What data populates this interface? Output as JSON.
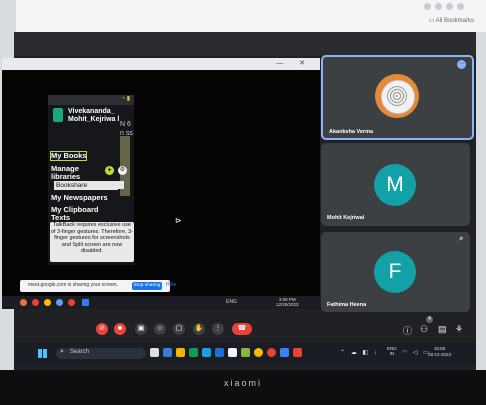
{
  "browser": {
    "bookmarks_label": "All Bookmarks"
  },
  "device": {
    "brand": "xiaomi"
  },
  "shared_window": {
    "window_controls": "— ✕",
    "phone_status_icons": "◔ ▮",
    "bg_fragments": "N 6 n ss",
    "app": {
      "user_name": "Vivekananda_ Mohit_Kejriwa l",
      "items": [
        {
          "label": "My Books",
          "highlighted": true
        },
        {
          "label": "Manage libraries",
          "highlighted": false
        },
        {
          "label": "My Newspapers",
          "highlighted": false
        },
        {
          "label": "My Clipboard Texts",
          "highlighted": false
        }
      ],
      "library_dropdown": "Bookshare",
      "toast": "TalkBack requires exclusive use of 3-finger gestures. Therefore, 3-finger gestures for screenshots and Split screen are now disabled."
    },
    "share_banner": {
      "text": "meet.google.com is sharing your screen.",
      "stop_label": "Stop sharing",
      "hide_label": "Hide"
    },
    "inner_taskbar": {
      "tray": "ENG",
      "time": "3:58 PM",
      "date": "12/28/2023"
    }
  },
  "participants": [
    {
      "name": "Akanksha Verma",
      "avatar": "photo",
      "active": true
    },
    {
      "name": "Mohit Kejriwal",
      "avatar": "M",
      "active": false
    },
    {
      "name": "Fathima Heena",
      "avatar": "F",
      "active": false
    }
  ],
  "controls": {
    "hangup_icon": "phone-end-icon",
    "participant_count": "4"
  },
  "taskbar": {
    "search_placeholder": "Search",
    "language_line1": "ENG",
    "language_line2": "IN",
    "time": "15:58",
    "date": "28-12-2023"
  },
  "colors": {
    "meet_tile_bg": "#3c4043",
    "avatar_teal": "#12a1a7",
    "hangup_red": "#ea4335",
    "active_border": "#8ab4f8",
    "toast_bg": "#e9e9e9"
  }
}
